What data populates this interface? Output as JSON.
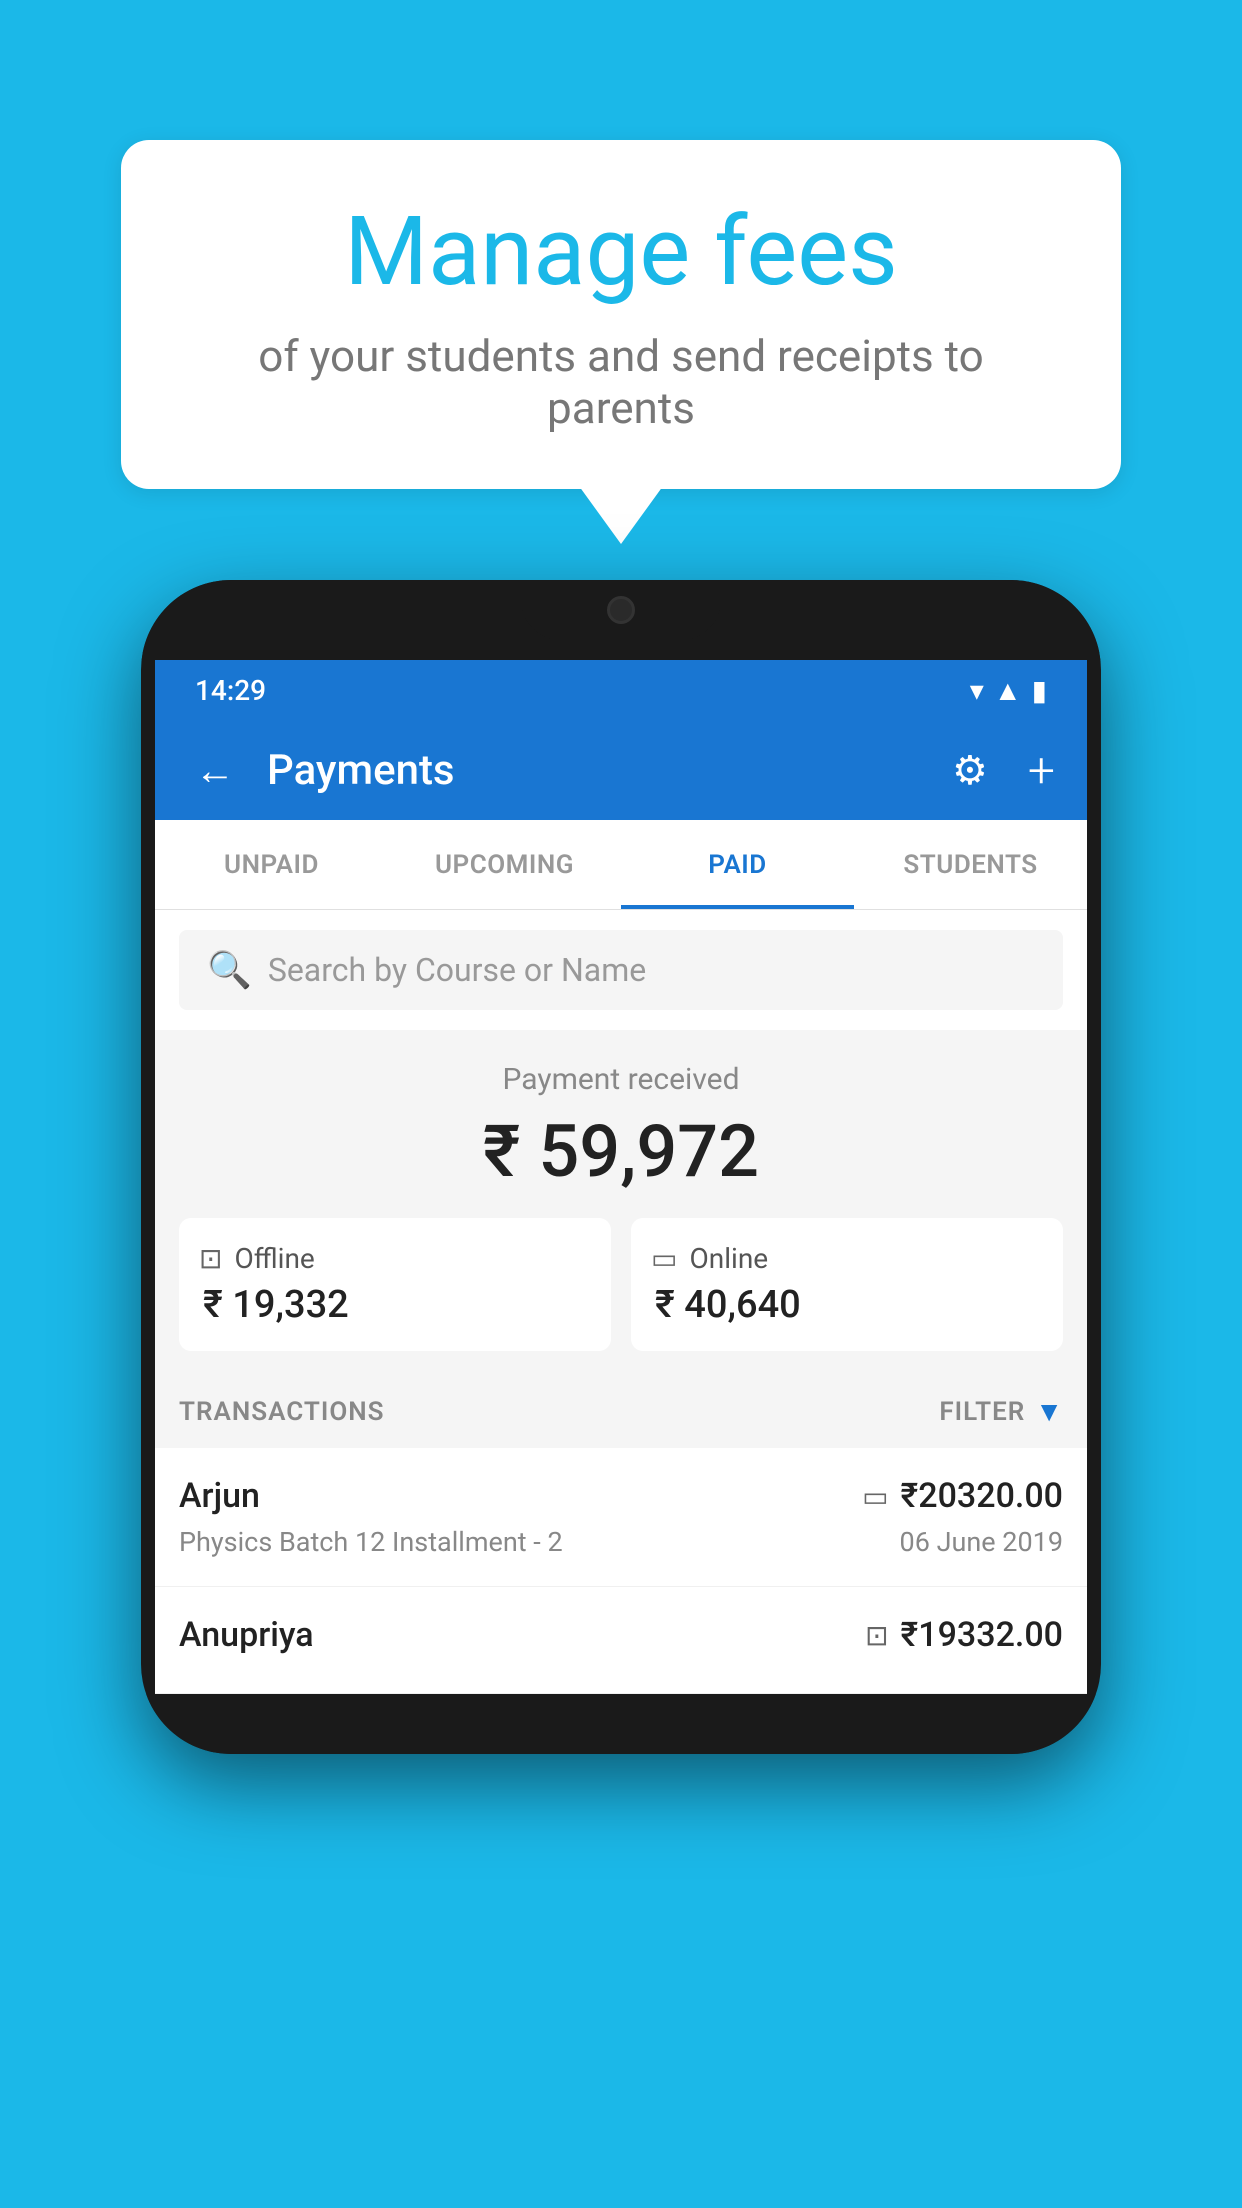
{
  "background_color": "#1bb8e8",
  "speech_bubble": {
    "title": "Manage fees",
    "subtitle": "of your students and send receipts to parents"
  },
  "phone": {
    "status_bar": {
      "time": "14:29",
      "wifi": "▾",
      "signal": "▲",
      "battery": "▮"
    },
    "header": {
      "back_label": "←",
      "title": "Payments",
      "gear_label": "⚙",
      "plus_label": "+"
    },
    "tabs": [
      {
        "label": "UNPAID",
        "active": false
      },
      {
        "label": "UPCOMING",
        "active": false
      },
      {
        "label": "PAID",
        "active": true
      },
      {
        "label": "STUDENTS",
        "active": false
      }
    ],
    "search": {
      "placeholder": "Search by Course or Name"
    },
    "payment_summary": {
      "label": "Payment received",
      "amount": "₹ 59,972",
      "offline_label": "Offline",
      "offline_amount": "₹ 19,332",
      "online_label": "Online",
      "online_amount": "₹ 40,640"
    },
    "transactions": {
      "section_label": "TRANSACTIONS",
      "filter_label": "FILTER",
      "rows": [
        {
          "name": "Arjun",
          "course": "Physics Batch 12 Installment - 2",
          "amount": "₹20320.00",
          "date": "06 June 2019",
          "payment_type": "online"
        },
        {
          "name": "Anupriya",
          "course": "",
          "amount": "₹19332.00",
          "date": "",
          "payment_type": "offline"
        }
      ]
    }
  }
}
